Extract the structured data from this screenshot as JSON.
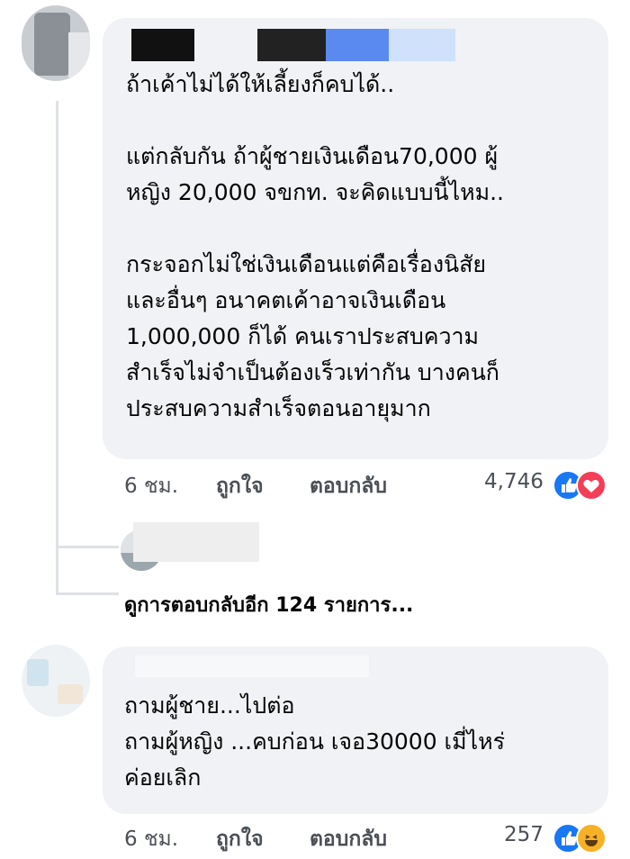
{
  "comment1": {
    "text": "ถ้าเค้าไม่ได้ให้เลี้ยงก็คบได้..\n\nแต่กลับกัน ถ้าผู้ชายเงินเดือน70,000 ผู้\nหญิง 20,000 จขกท. จะคิดแบบนี้ไหม..\n\nกระจอกไม่ใช่เงินเดือนแต่คือเรื่องนิสัย\nและอื่นๆ อนาคตเค้าอาจเงินเดือน\n1,000,000 ก็ได้ คนเราประสบความ\nสำเร็จไม่จำเป็นต้องเร็วเท่ากัน บางคนก็\nประสบความสำเร็จตอนอายุมาก",
    "time": "6 ชม.",
    "like": "ถูกใจ",
    "reply": "ตอบกลับ",
    "reaction_count": "4,746",
    "reactions": [
      "like-icon",
      "love-icon"
    ]
  },
  "more_replies": "ดูการตอบกลับอีก 124 รายการ...",
  "comment2": {
    "text": "ถามผู้ชาย...ไปต่อ\nถามผู้หญิง ...คบก่อน เจอ30000 เมี่ไหร่\nค่อยเลิก",
    "time": "6 ชม.",
    "like": "ถูกใจ",
    "reply": "ตอบกลับ",
    "reaction_count": "257",
    "reactions": [
      "like-icon",
      "haha-icon"
    ]
  },
  "colors": {
    "bubble": "#f0f2f5",
    "text": "#050505",
    "secondary": "#4b4f56",
    "like_blue": "#1877f2",
    "love_red": "#f33e58",
    "haha_yellow": "#f7b125"
  }
}
